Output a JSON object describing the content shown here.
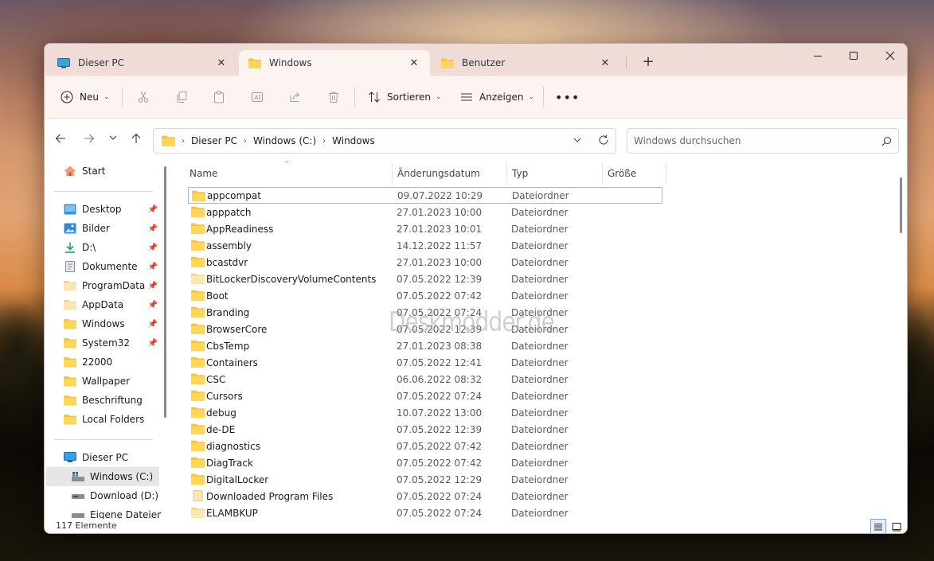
{
  "tabs": [
    {
      "label": "Dieser PC",
      "icon": "monitor-icon"
    },
    {
      "label": "Windows",
      "icon": "folder-icon",
      "active": true
    },
    {
      "label": "Benutzer",
      "icon": "folder-icon"
    }
  ],
  "toolbar": {
    "new_label": "Neu",
    "sort_label": "Sortieren",
    "view_label": "Anzeigen"
  },
  "breadcrumb": [
    "Dieser PC",
    "Windows (C:)",
    "Windows"
  ],
  "search": {
    "placeholder": "Windows durchsuchen"
  },
  "sidebar": {
    "home": "Start",
    "pinned": [
      {
        "label": "Desktop",
        "icon": "desktop-icon"
      },
      {
        "label": "Bilder",
        "icon": "pictures-icon"
      },
      {
        "label": "D:\\",
        "icon": "download-icon"
      },
      {
        "label": "Dokumente",
        "icon": "documents-icon"
      },
      {
        "label": "ProgramData",
        "icon": "folder-icon"
      },
      {
        "label": "AppData",
        "icon": "folder-icon"
      },
      {
        "label": "Windows",
        "icon": "folder-icon"
      },
      {
        "label": "System32",
        "icon": "folder-icon"
      }
    ],
    "folders": [
      "22000",
      "Wallpaper",
      "Beschriftung",
      "Local Folders"
    ],
    "this_pc": "Dieser PC",
    "drives": [
      "Windows (C:)",
      "Download (D:)",
      "Eigene Dateien (E"
    ]
  },
  "columns": {
    "name": "Name",
    "date": "Änderungsdatum",
    "type": "Typ",
    "size": "Größe"
  },
  "files": [
    {
      "name": "appcompat",
      "date": "09.07.2022 10:29",
      "type": "Dateiordner"
    },
    {
      "name": "apppatch",
      "date": "27.01.2023 10:00",
      "type": "Dateiordner"
    },
    {
      "name": "AppReadiness",
      "date": "27.01.2023 10:01",
      "type": "Dateiordner"
    },
    {
      "name": "assembly",
      "date": "14.12.2022 11:57",
      "type": "Dateiordner"
    },
    {
      "name": "bcastdvr",
      "date": "27.01.2023 10:00",
      "type": "Dateiordner"
    },
    {
      "name": "BitLockerDiscoveryVolumeContents",
      "date": "07.05.2022 12:39",
      "type": "Dateiordner"
    },
    {
      "name": "Boot",
      "date": "07.05.2022 07:42",
      "type": "Dateiordner"
    },
    {
      "name": "Branding",
      "date": "07.05.2022 07:24",
      "type": "Dateiordner"
    },
    {
      "name": "BrowserCore",
      "date": "07.05.2022 12:39",
      "type": "Dateiordner"
    },
    {
      "name": "CbsTemp",
      "date": "27.01.2023 08:38",
      "type": "Dateiordner"
    },
    {
      "name": "Containers",
      "date": "07.05.2022 12:41",
      "type": "Dateiordner"
    },
    {
      "name": "CSC",
      "date": "06.06.2022 08:32",
      "type": "Dateiordner"
    },
    {
      "name": "Cursors",
      "date": "07.05.2022 07:24",
      "type": "Dateiordner"
    },
    {
      "name": "debug",
      "date": "10.07.2022 13:00",
      "type": "Dateiordner"
    },
    {
      "name": "de-DE",
      "date": "07.05.2022 12:39",
      "type": "Dateiordner"
    },
    {
      "name": "diagnostics",
      "date": "07.05.2022 07:42",
      "type": "Dateiordner"
    },
    {
      "name": "DiagTrack",
      "date": "07.05.2022 07:42",
      "type": "Dateiordner"
    },
    {
      "name": "DigitalLocker",
      "date": "07.05.2022 12:29",
      "type": "Dateiordner"
    },
    {
      "name": "Downloaded Program Files",
      "date": "07.05.2022 07:24",
      "type": "Dateiordner"
    },
    {
      "name": "ELAMBKUP",
      "date": "07.05.2022 07:24",
      "type": "Dateiordner"
    }
  ],
  "watermark": "Deskmodder.de",
  "status": {
    "count": "117 Elemente"
  },
  "colors": {
    "accent": "#0067c0",
    "folder": "#f6c443",
    "tabstrip": "#f0dcd6",
    "toolbar": "#fbf4f1"
  }
}
